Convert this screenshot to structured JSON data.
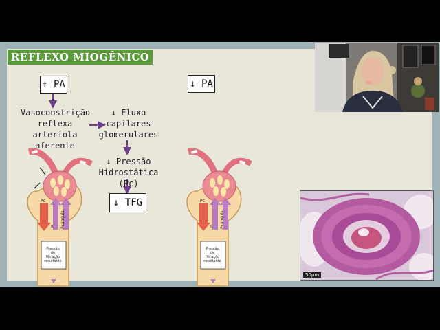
{
  "slide": {
    "title": "REFLEXO MIOGÊNICO",
    "left": {
      "box_pa": "↑ PA",
      "vasoconstriction": [
        "Vasoconstrição",
        "reflexa arteríola",
        "aferente"
      ],
      "flow": [
        "↓ Fluxo",
        "capilares",
        "glomerulares"
      ],
      "pressure": [
        "↓ Pressão",
        "Hidrostática (Pc)"
      ],
      "box_tfg": "↓ TFG"
    },
    "right": {
      "box_pa": "↓ PA"
    },
    "nephron_labels": {
      "pc": "Pc",
      "pi": "π",
      "pcapsula": "Pcápsula",
      "net_pressure": [
        "Pressão",
        "de",
        "filtração",
        "resultante"
      ]
    }
  },
  "histology": {
    "scale_label": "50µm"
  },
  "colors": {
    "slide_bg": "#e9e7da",
    "frame": "#9eb1b4",
    "title_bg": "#5b9a3c",
    "arrow": "#6b3f8c"
  }
}
